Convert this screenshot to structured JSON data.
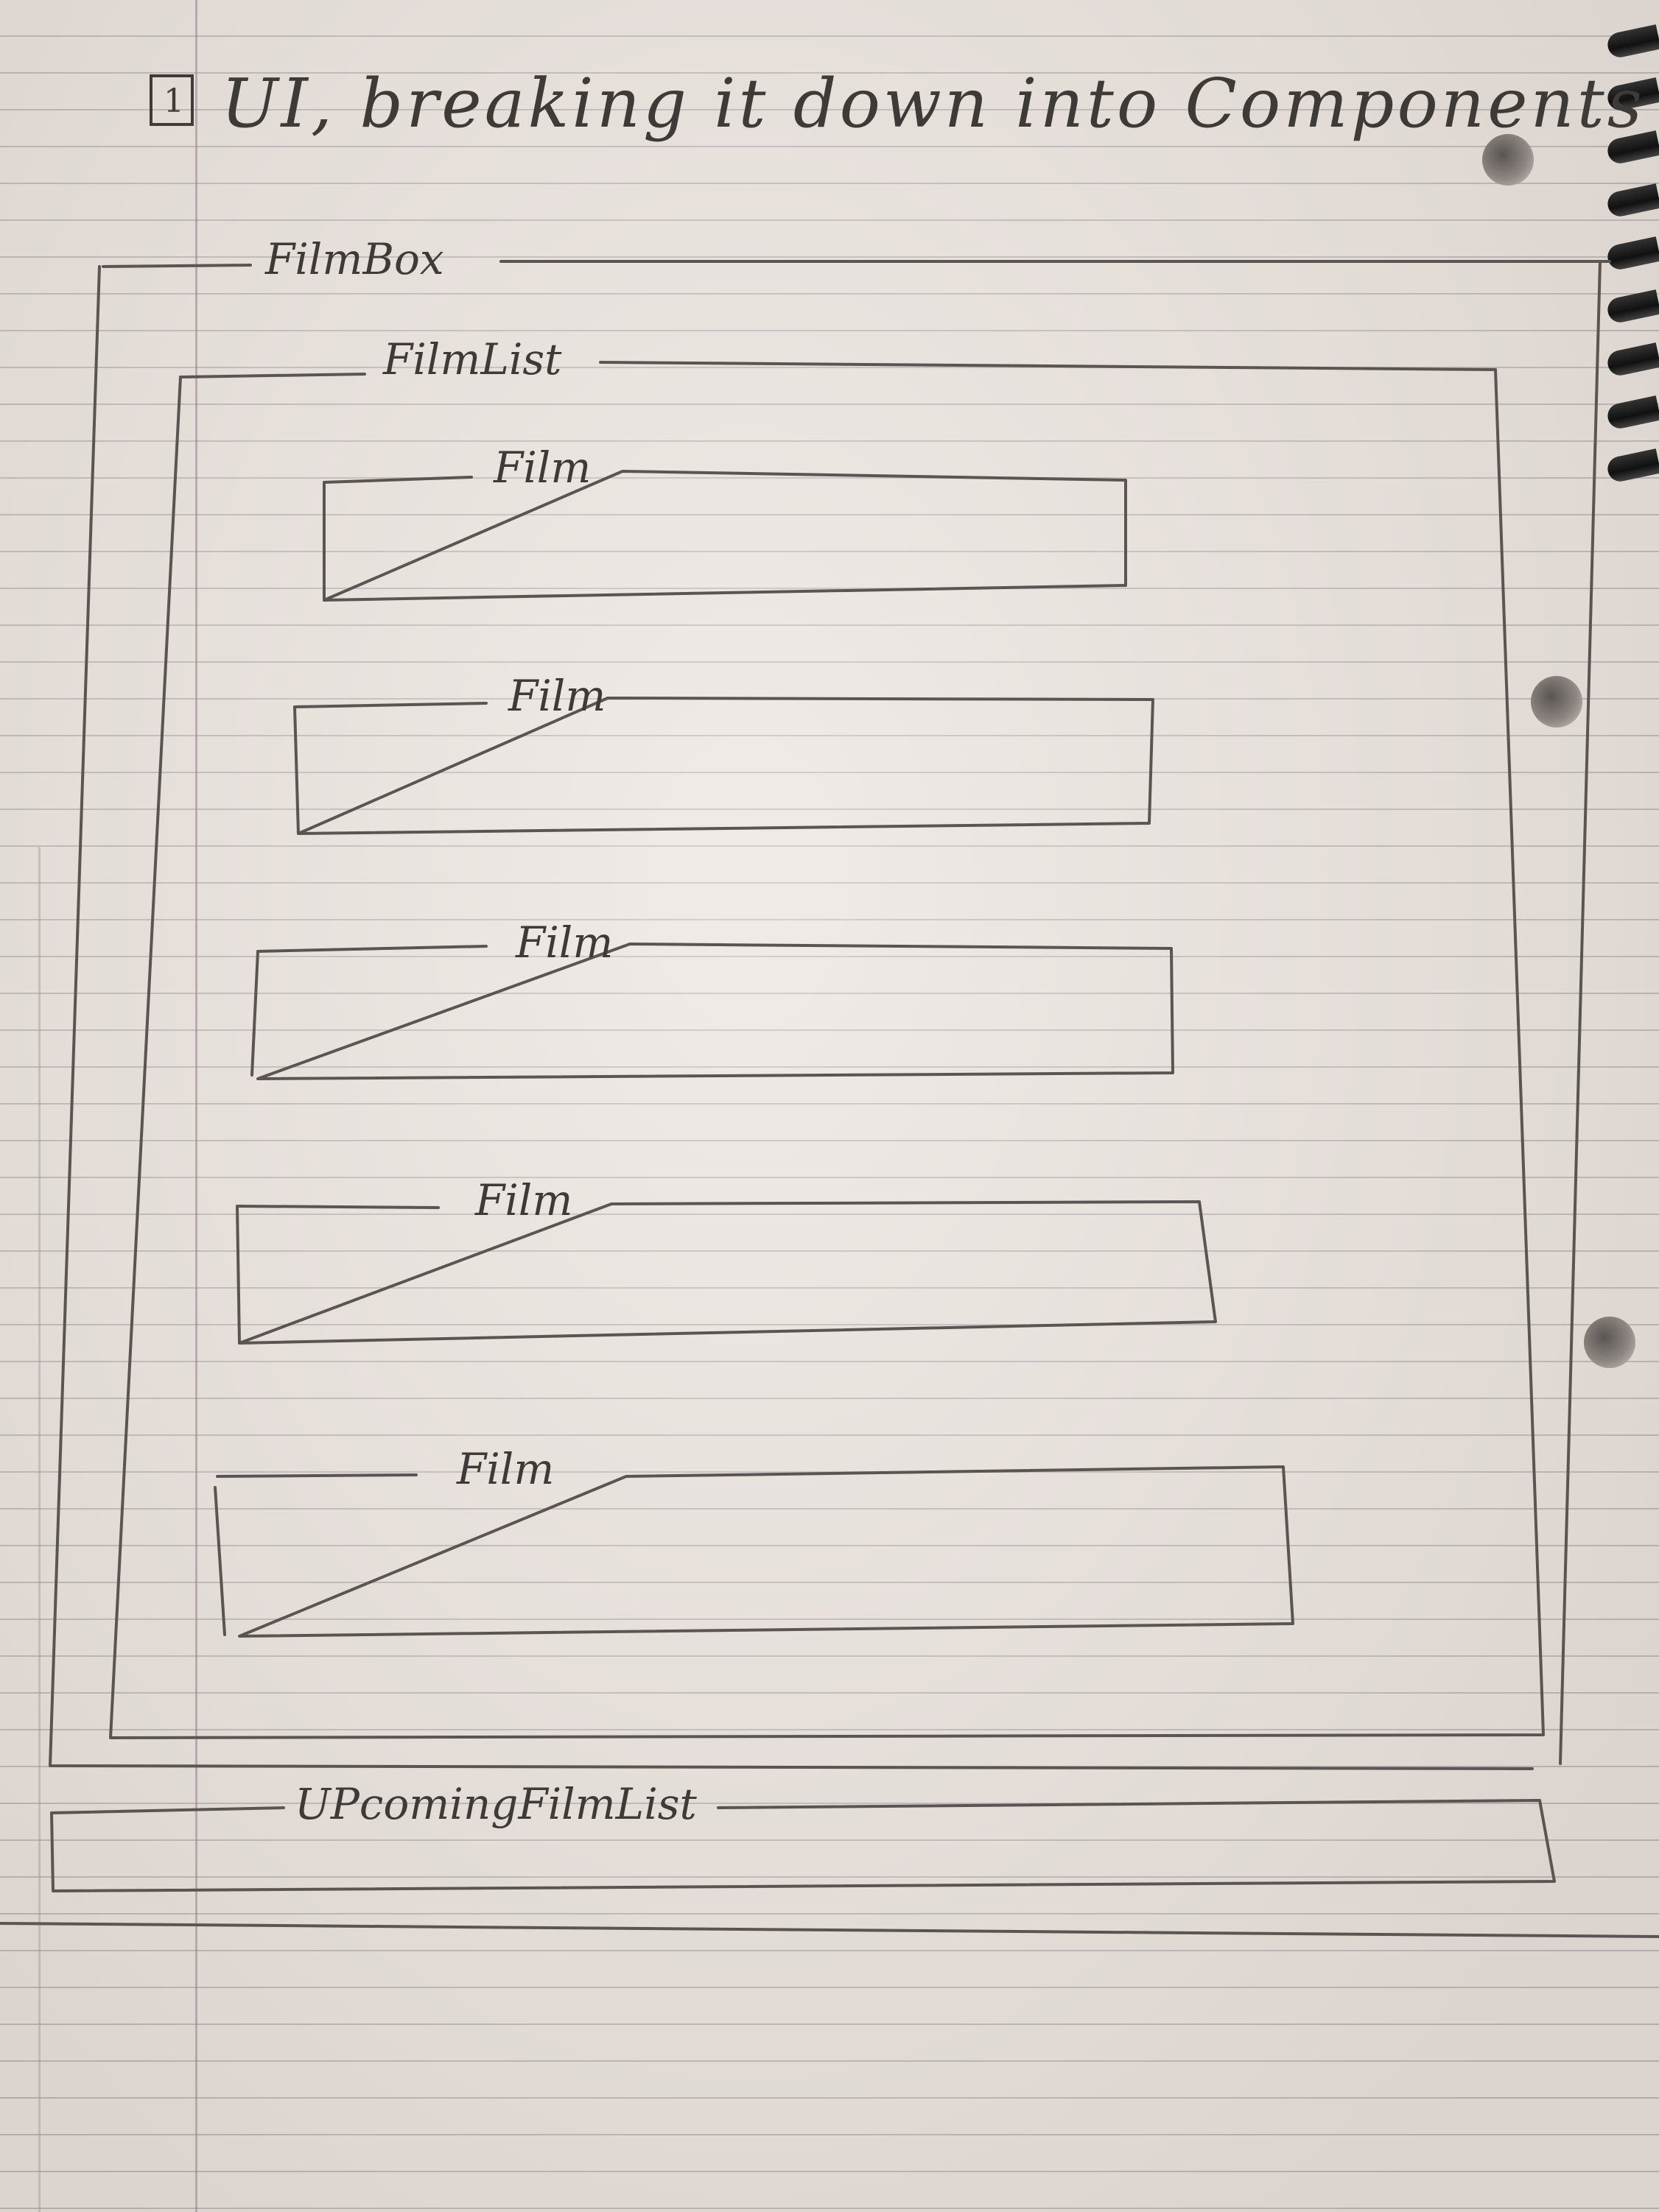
{
  "title": {
    "badge": "1",
    "text": "UI, breaking it down into Components"
  },
  "diagram": {
    "outer": {
      "label": "FilmBox"
    },
    "list": {
      "label": "FilmList"
    },
    "items": [
      {
        "label": "Film"
      },
      {
        "label": "Film"
      },
      {
        "label": "Film"
      },
      {
        "label": "Film"
      },
      {
        "label": "Film"
      }
    ],
    "bottom": {
      "label": "UPcomingFilmList"
    }
  },
  "colors": {
    "paper": "#e9e1db",
    "pencil": "#5a5552"
  }
}
